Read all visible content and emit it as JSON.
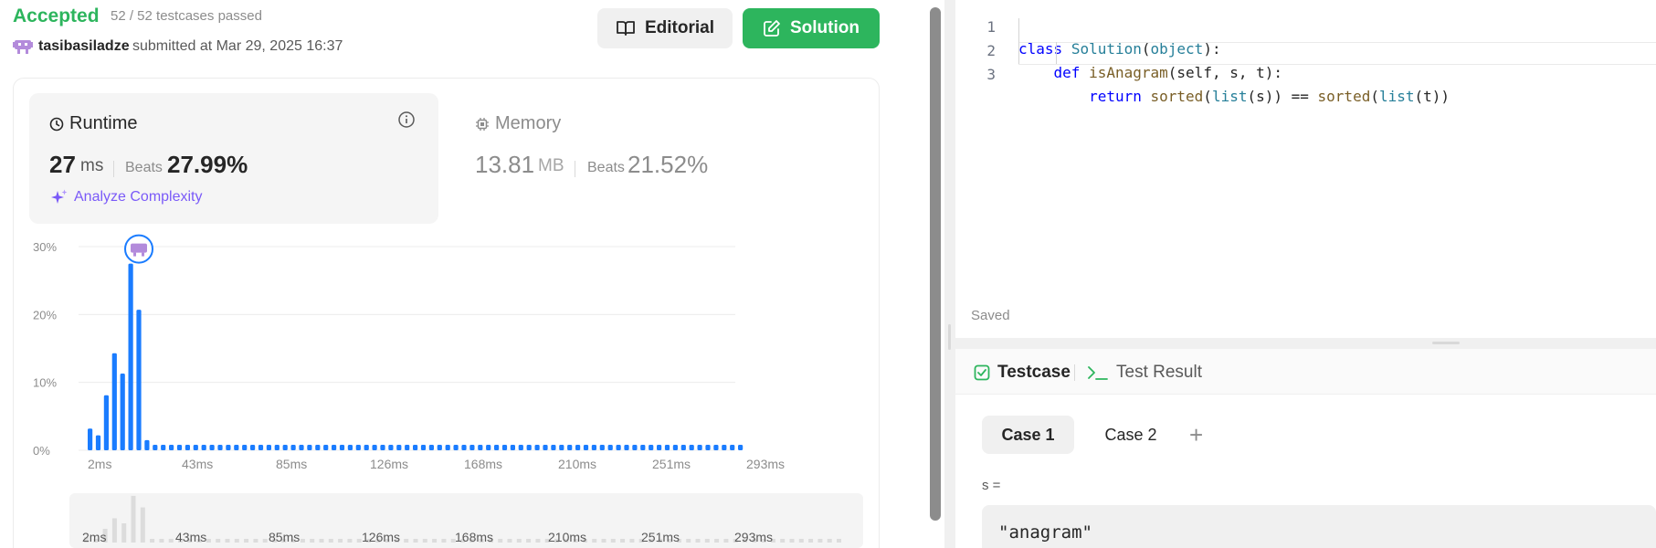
{
  "submission": {
    "status": "Accepted",
    "cases_passed": "52 / 52 testcases passed",
    "username": "tasibasiladze",
    "submitted_text": "submitted at Mar 29, 2025 16:37"
  },
  "buttons": {
    "editorial": "Editorial",
    "solution": "Solution"
  },
  "runtime": {
    "label": "Runtime",
    "value": "27",
    "unit": "ms",
    "beats_label": "Beats",
    "beats_value": "27.99%",
    "analyze": "Analyze Complexity"
  },
  "memory": {
    "label": "Memory",
    "value": "13.81",
    "unit": "MB",
    "beats_label": "Beats",
    "beats_value": "21.52%"
  },
  "colors": {
    "accepted": "#2db55d",
    "bar": "#1a7cff",
    "analyze": "#7a5af8",
    "avatar": "#b38bdb"
  },
  "chart_data": {
    "type": "bar",
    "x_tick_labels": [
      "2ms",
      "43ms",
      "85ms",
      "126ms",
      "168ms",
      "210ms",
      "251ms",
      "293ms"
    ],
    "y_tick_labels": [
      "0%",
      "10%",
      "20%",
      "30%"
    ],
    "ylim": [
      0,
      30
    ],
    "grid": true,
    "highlight_index": 6,
    "values": [
      3.2,
      2.2,
      8.1,
      14.3,
      11.3,
      27.5,
      20.7,
      1.5,
      0.8,
      0.8,
      0.8,
      0.8,
      0.8,
      0.8,
      0.8,
      0.8,
      0.8,
      0.8,
      0.8,
      0.8,
      0.8,
      0.8,
      0.8,
      0.8,
      0.8,
      0.8,
      0.8,
      0.8,
      0.8,
      0.8,
      0.8,
      0.8,
      0.8,
      0.8,
      0.8,
      0.8,
      0.8,
      0.8,
      0.8,
      0.8,
      0.8,
      0.8,
      0.8,
      0.8,
      0.8,
      0.8,
      0.8,
      0.8,
      0.8,
      0.8,
      0.8,
      0.8,
      0.8,
      0.8,
      0.8,
      0.8,
      0.8,
      0.8,
      0.8,
      0.8,
      0.8,
      0.8,
      0.8,
      0.8,
      0.8,
      0.8,
      0.8,
      0.8,
      0.8,
      0.8,
      0.8,
      0.8,
      0.8,
      0.8,
      0.8,
      0.8,
      0.8,
      0.8,
      0.8,
      0.8,
      0.8
    ]
  },
  "editor": {
    "lines": [
      {
        "num": "1"
      },
      {
        "num": "2"
      },
      {
        "num": "3"
      }
    ],
    "code_tokens": {
      "l1": [
        "class",
        " ",
        "Solution",
        "(",
        "object",
        "):"
      ],
      "l2": [
        "    ",
        "def",
        " ",
        "isAnagram",
        "(self, s, t):"
      ],
      "l3": [
        "        ",
        "return",
        " ",
        "sorted",
        "(",
        "list",
        "(s)) == ",
        "sorted",
        "(",
        "list",
        "(t))"
      ]
    },
    "saved": "Saved"
  },
  "testcase_panel": {
    "tab_testcase": "Testcase",
    "tab_result": "Test Result",
    "cases": [
      "Case 1",
      "Case 2"
    ],
    "add": "+",
    "param_label": "s =",
    "param_value": "\"anagram\""
  }
}
